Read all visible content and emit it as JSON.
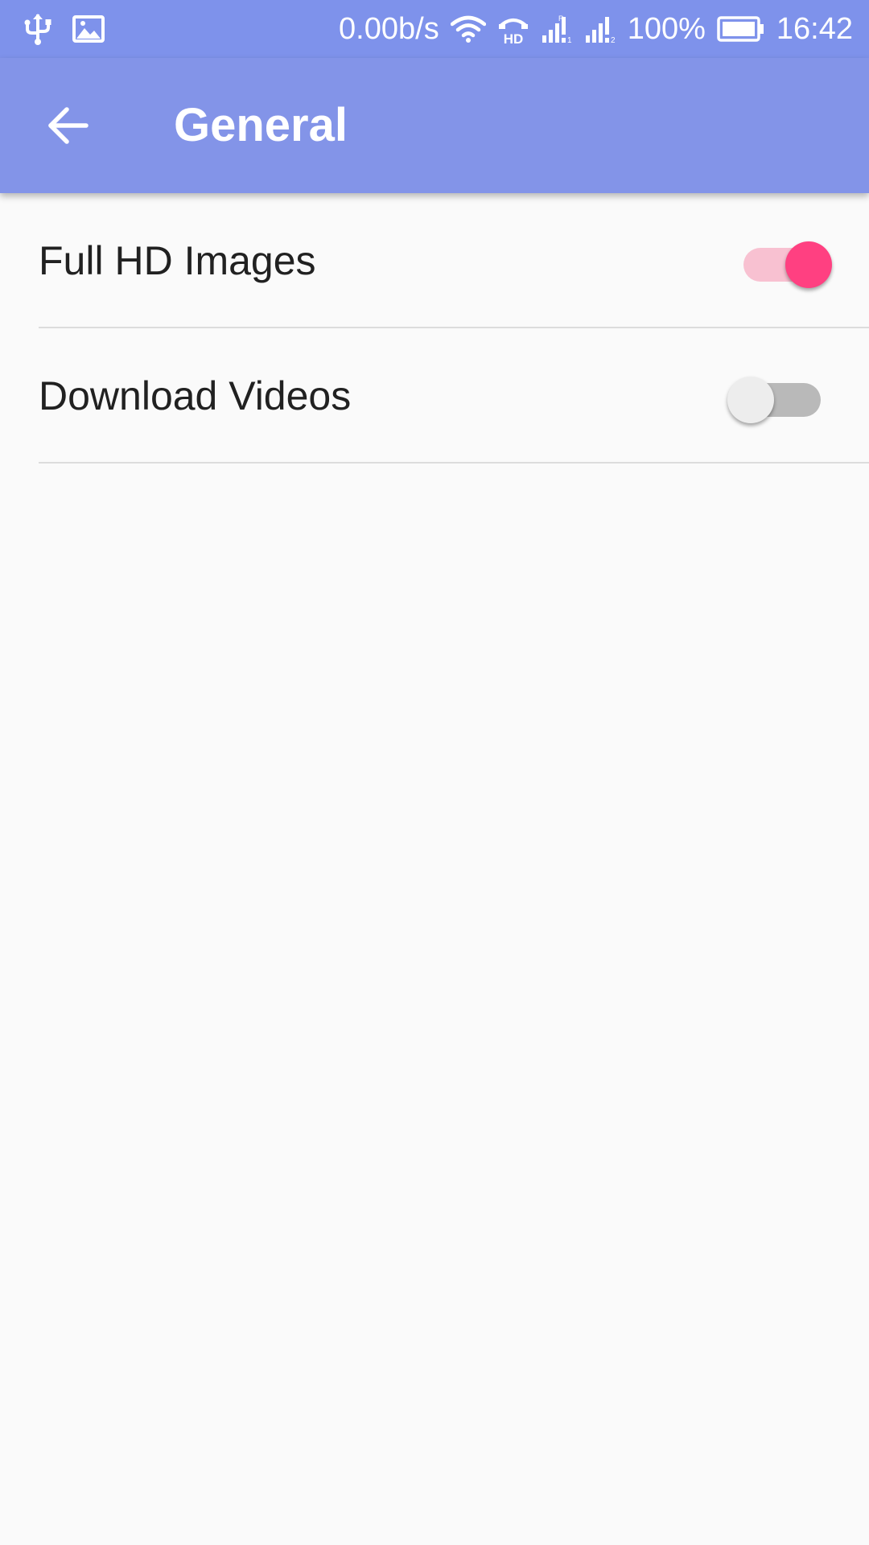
{
  "status_bar": {
    "left_icons": [
      "usb-icon",
      "image-notification-icon"
    ],
    "network_speed": "0.00b/s",
    "right_icons": [
      "wifi-icon",
      "hd-voice-icon",
      "signal-roaming-icon",
      "signal-icon"
    ],
    "battery_percent": "100%",
    "time": "16:42"
  },
  "app_bar": {
    "back_icon": "arrow-back-icon",
    "title": "General"
  },
  "settings": [
    {
      "label": "Full HD Images",
      "enabled": true
    },
    {
      "label": "Download Videos",
      "enabled": false
    }
  ],
  "colors": {
    "status_bar": "#7E92EB",
    "app_bar": "#8394E8",
    "accent": "#FF4081",
    "accent_track": "#F8C1D1",
    "switch_off_thumb": "#EDEDED",
    "switch_off_track": "#B9B9B9",
    "background": "#FAFAFA"
  }
}
